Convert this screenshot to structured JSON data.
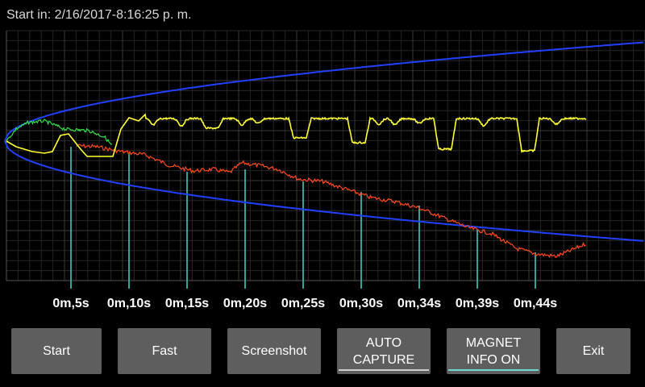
{
  "header": {
    "start_label": "Start in: 2/16/2017-8:16:25 p. m."
  },
  "time_ticks": [
    "0m,5s",
    "0m,10s",
    "0m,15s",
    "0m,20s",
    "0m,25s",
    "0m,30s",
    "0m,34s",
    "0m,39s",
    "0m,44s"
  ],
  "buttons": {
    "start": "Start",
    "fast": "Fast",
    "screenshot": "Screenshot",
    "auto_capture": "AUTO\nCAPTURE",
    "magnet_info": "MAGNET\nINFO ON",
    "exit": "Exit"
  },
  "colors": {
    "background": "#000000",
    "grid": "#3a3a3a",
    "envelope": "#2040ff",
    "yellow_trace": "#ffff33",
    "red_trace": "#ff4a1a",
    "green_trace": "#33dd44",
    "marker": "#40c8c0",
    "button_bg": "#5e5e5e",
    "auto_capture_underline": "#cfcfcf",
    "magnet_info_underline": "#6fd8d0"
  }
}
